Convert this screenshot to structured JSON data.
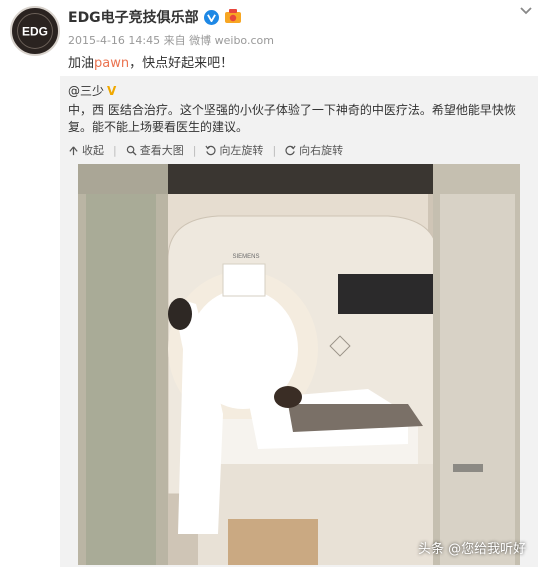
{
  "post": {
    "author": "EDG电子竞技俱乐部",
    "avatar_logo_text": "EDG",
    "timestamp": "2015-4-16 14:45",
    "source": "来自 微博 weibo.com",
    "text_before": "加油",
    "text_highlight": "pawn",
    "text_after": "，快点好起来吧！"
  },
  "repost": {
    "author": "@三少",
    "text": "中，西 医结合治疗。这个坚强的小伙子体验了一下神奇的中医疗法。希望他能早快恢复。能不能上场要看医生的建议。",
    "actions": {
      "collect": "收起",
      "view_large": "查看大图",
      "rotate_left": "向左旋转",
      "rotate_right": "向右旋转"
    },
    "photo": {
      "brand_text": "SIEMENS"
    }
  },
  "watermark": "头条 @您给我听好",
  "icons": {
    "verified": "verified-icon",
    "medal": "medal-icon",
    "menu": "chevron-down-icon"
  },
  "colors": {
    "highlight": "#eb7350",
    "verified_blue": "#1e88e5",
    "gold_v": "#f0a800",
    "repost_bg": "#f2f2f2"
  }
}
